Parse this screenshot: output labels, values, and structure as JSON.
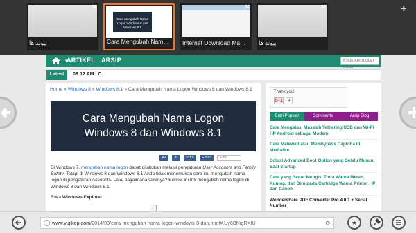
{
  "tabs": [
    {
      "caption": "پیوند ها",
      "active": false
    },
    {
      "caption": "Cara Mengubah Nama Logon",
      "active": true
    },
    {
      "caption": "Internet Download Manager: t…",
      "active": false
    },
    {
      "caption": "پیوند ها",
      "active": false
    }
  ],
  "tab_thumb_hero": "Cara Mengubah Nama Logon Windows 8 dan Windows 8.1",
  "new_tab_glyph": "+",
  "close_glyph": "×",
  "site_nav": {
    "menu": [
      "ARTIKEL",
      "ARSIP"
    ],
    "search_placeholder": "Ketik kemudian enter"
  },
  "latest": {
    "label": "Latest",
    "text": "06:12 AM | C"
  },
  "breadcrumb": {
    "home": "Home",
    "sep": "»",
    "l1": "Windows 8",
    "l2": "Windows 8.1",
    "current": "Cara Mengubah Nama Logon Windows 8 dan Windows 8.1"
  },
  "hero": {
    "line1": "Cara Mengubah Nama Logon",
    "line2": "Windows 8 dan Windows 8.1"
  },
  "article_tools": {
    "a_plus": "A+",
    "a_minus": "A-",
    "print": "Print",
    "email": "Email",
    "find": "Find"
  },
  "article": {
    "p1_a": "Di Windows 7, ",
    "p1_link": "mengubah nama logon",
    "p1_b": " dapat dilakukan melalui pengaturan ",
    "p1_em": "User Accounts and Family Safety",
    "p1_c": ". Tetapi di Windows 8 dan Windows 8.1 Anda tidak menemukan cara itu, mengubah nama logon di pengaturan Accounts. Lalu, bagaimana caranya? Berikut ini trik mengubah nama logon di Windows 8 dan Windows 8.1.",
    "p2_a": "Buka ",
    "p2_b": "Windows Explorer",
    "p2_c": "."
  },
  "sidebar": {
    "thanks": "Thank you!",
    "gplus": "G+1",
    "count": "4",
    "tabs": [
      "Entri Populer",
      "Comments",
      "Arsip Blog"
    ],
    "items": [
      "Cara Mengatasi Masalah Tethering USB dan Wi-Fi HP Android sebagai Modem",
      "Cara Melewati atau Membypass Captcha di Mediafire",
      "Solusi Advanced Boot Option yang Selalu Muncul Saat Startup",
      "Cara yang Benar Mengisi Tinta Warna Merah, Kuning, dan Biru pada Cartridge Warna Printer HP dan Canon",
      "Wondershare PDF Converter Pro 4.0.1 + Serial Number"
    ]
  },
  "address": {
    "domain": "www.yujikop.com",
    "path": "/2014/03/cara-mengubah-nama-logon-windows-8-dan.html#.Uy6BNigRXIU"
  },
  "colors": {
    "accent_green": "#1e8b73",
    "tab_orange": "#e8742f",
    "hero_bg": "#1f2c3e"
  }
}
